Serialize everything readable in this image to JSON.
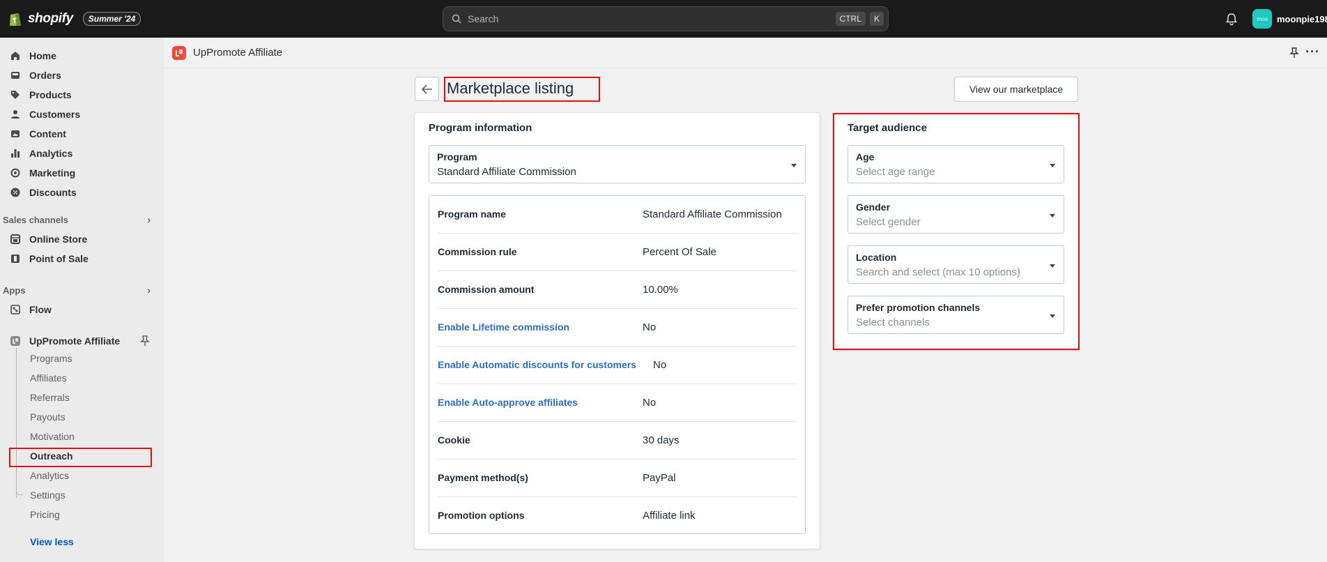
{
  "topbar": {
    "brand": "shopify",
    "edition": "Summer '24",
    "search_placeholder": "Search",
    "shortcut_key1": "CTRL",
    "shortcut_key2": "K",
    "avatar_initials": "moo",
    "account_name": "moonpie198"
  },
  "sidebar": {
    "main_items": [
      {
        "label": "Home",
        "icon": "home-icon"
      },
      {
        "label": "Orders",
        "icon": "inbox-icon"
      },
      {
        "label": "Products",
        "icon": "tag-icon"
      },
      {
        "label": "Customers",
        "icon": "person-icon"
      },
      {
        "label": "Content",
        "icon": "image-icon"
      },
      {
        "label": "Analytics",
        "icon": "bar-chart-icon"
      },
      {
        "label": "Marketing",
        "icon": "target-icon"
      },
      {
        "label": "Discounts",
        "icon": "discount-icon"
      }
    ],
    "sales_channels_title": "Sales channels",
    "sales_channels": [
      {
        "label": "Online Store",
        "icon": "store-icon"
      },
      {
        "label": "Point of Sale",
        "icon": "pos-icon"
      }
    ],
    "apps_title": "Apps",
    "apps": [
      {
        "label": "Flow",
        "icon": "flow-icon"
      }
    ],
    "pinned_app": "UpPromote Affiliate",
    "app_subitems": [
      "Programs",
      "Affiliates",
      "Referrals",
      "Payouts",
      "Motivation",
      "Outreach",
      "Analytics",
      "Settings",
      "Pricing"
    ],
    "active_subitem": "Outreach",
    "view_less": "View less"
  },
  "app_header": {
    "title": "UpPromote Affiliate"
  },
  "page": {
    "title": "Marketplace listing",
    "view_marketplace_button": "View our marketplace"
  },
  "program_card": {
    "title": "Program information",
    "program_select": {
      "label": "Program",
      "value": "Standard Affiliate Commission"
    },
    "rows": [
      {
        "key": "Program name",
        "value": "Standard Affiliate Commission"
      },
      {
        "key": "Commission rule",
        "value": "Percent Of Sale"
      },
      {
        "key": "Commission amount",
        "value": "10.00%"
      },
      {
        "key": "Enable Lifetime commission",
        "value": "No"
      },
      {
        "key": "Enable Automatic discounts for customers",
        "value": "No"
      },
      {
        "key": "Enable Auto-approve affiliates",
        "value": "No"
      },
      {
        "key": "Cookie",
        "value": "30 days"
      },
      {
        "key": "Payment method(s)",
        "value": "PayPal"
      },
      {
        "key": "Promotion options",
        "value": "Affiliate link"
      }
    ]
  },
  "target_card": {
    "title": "Target audience",
    "fields": [
      {
        "label": "Age",
        "placeholder": "Select age range"
      },
      {
        "label": "Gender",
        "placeholder": "Select gender"
      },
      {
        "label": "Location",
        "placeholder": "Search and select (max 10 options)"
      },
      {
        "label": "Prefer promotion channels",
        "placeholder": "Select channels"
      }
    ]
  },
  "colors": {
    "topbar": "#1a1a1a",
    "highlight": "#e20f0f",
    "link": "#2c6ecb",
    "app_accent": "#f04a3a"
  }
}
